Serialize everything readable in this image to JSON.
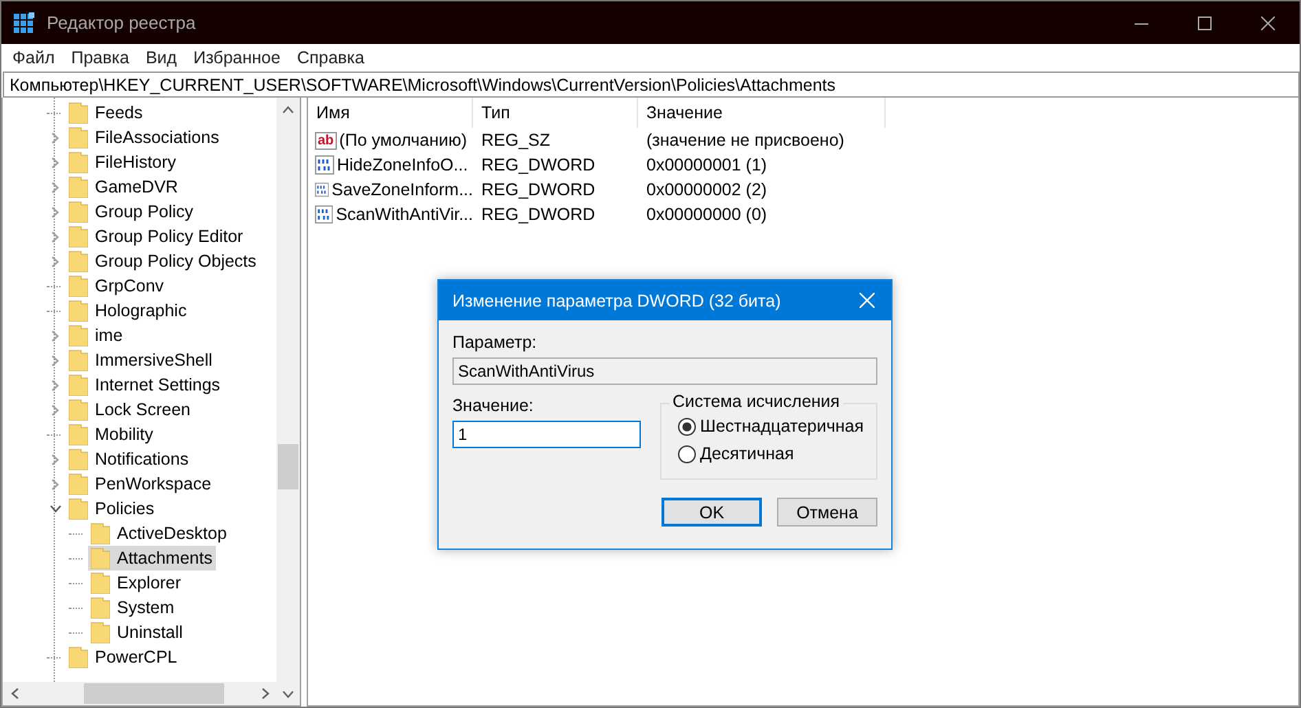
{
  "window": {
    "title": "Редактор реестра"
  },
  "menu": [
    "Файл",
    "Правка",
    "Вид",
    "Избранное",
    "Справка"
  ],
  "address": {
    "value": "Компьютер\\HKEY_CURRENT_USER\\SOFTWARE\\Microsoft\\Windows\\CurrentVersion\\Policies\\Attachments"
  },
  "tree": {
    "items": [
      {
        "label": "Feeds",
        "has_children": false,
        "selected": false
      },
      {
        "label": "FileAssociations",
        "has_children": true,
        "expanded": false,
        "selected": false
      },
      {
        "label": "FileHistory",
        "has_children": true,
        "expanded": false,
        "selected": false
      },
      {
        "label": "GameDVR",
        "has_children": true,
        "expanded": false,
        "selected": false
      },
      {
        "label": "Group Policy",
        "has_children": true,
        "expanded": false,
        "selected": false
      },
      {
        "label": "Group Policy Editor",
        "has_children": true,
        "expanded": false,
        "selected": false
      },
      {
        "label": "Group Policy Objects",
        "has_children": true,
        "expanded": false,
        "selected": false
      },
      {
        "label": "GrpConv",
        "has_children": false,
        "selected": false
      },
      {
        "label": "Holographic",
        "has_children": false,
        "selected": false
      },
      {
        "label": "ime",
        "has_children": true,
        "expanded": false,
        "selected": false
      },
      {
        "label": "ImmersiveShell",
        "has_children": true,
        "expanded": false,
        "selected": false
      },
      {
        "label": "Internet Settings",
        "has_children": true,
        "expanded": false,
        "selected": false
      },
      {
        "label": "Lock Screen",
        "has_children": true,
        "expanded": false,
        "selected": false
      },
      {
        "label": "Mobility",
        "has_children": false,
        "selected": false
      },
      {
        "label": "Notifications",
        "has_children": true,
        "expanded": false,
        "selected": false
      },
      {
        "label": "PenWorkspace",
        "has_children": true,
        "expanded": false,
        "selected": false
      },
      {
        "label": "Policies",
        "has_children": true,
        "expanded": true,
        "selected": false,
        "children": [
          {
            "label": "ActiveDesktop",
            "has_children": false,
            "selected": false
          },
          {
            "label": "Attachments",
            "has_children": false,
            "selected": true
          },
          {
            "label": "Explorer",
            "has_children": false,
            "selected": false
          },
          {
            "label": "System",
            "has_children": false,
            "selected": false
          },
          {
            "label": "Uninstall",
            "has_children": false,
            "selected": false
          }
        ]
      },
      {
        "label": "PowerCPL",
        "has_children": false,
        "selected": false
      }
    ]
  },
  "values": {
    "columns": [
      "Имя",
      "Тип",
      "Значение"
    ],
    "rows": [
      {
        "kind": "string",
        "icon_label": "ab",
        "name": "(По умолчанию)",
        "type": "REG_SZ",
        "data": "(значение не присвоено)"
      },
      {
        "kind": "binary",
        "name": "HideZoneInfoO...",
        "type": "REG_DWORD",
        "data": "0x00000001 (1)"
      },
      {
        "kind": "binary",
        "name": "SaveZoneInform...",
        "type": "REG_DWORD",
        "data": "0x00000002 (2)"
      },
      {
        "kind": "binary",
        "name": "ScanWithAntiVir...",
        "type": "REG_DWORD",
        "data": "0x00000000 (0)"
      }
    ]
  },
  "dialog": {
    "title": "Изменение параметра DWORD (32 бита)",
    "param_label": "Параметр:",
    "param_value": "ScanWithAntiVirus",
    "value_label": "Значение:",
    "value": "1",
    "base_group": {
      "title": "Система исчисления",
      "options": [
        {
          "label": "Шестнадцатеричная",
          "selected": true
        },
        {
          "label": "Десятичная",
          "selected": false
        }
      ]
    },
    "buttons": [
      {
        "label": "OK",
        "default": true
      },
      {
        "label": "Отмена",
        "default": false
      }
    ]
  }
}
